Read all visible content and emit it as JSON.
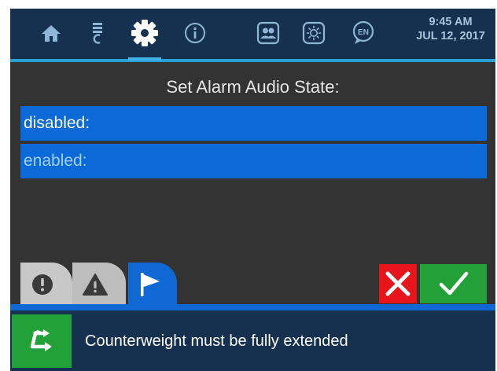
{
  "nav": {
    "icons": [
      "home-icon",
      "lamp-icon",
      "gear-icon",
      "info-icon",
      "users-icon",
      "brightness-icon",
      "language-icon"
    ],
    "language_badge": "EN",
    "active": "gear-icon"
  },
  "clock": {
    "time": "9:45 AM",
    "date": "JUL 12, 2017"
  },
  "page": {
    "title": "Set Alarm Audio State:",
    "options": [
      {
        "label": "disabled:",
        "state": "selected"
      },
      {
        "label": "enabled:",
        "state": "unselected"
      }
    ]
  },
  "tabs": [
    {
      "icon": "error-circle-icon",
      "active": false
    },
    {
      "icon": "warning-triangle-icon",
      "active": false
    },
    {
      "icon": "flag-icon",
      "active": true
    }
  ],
  "actions": {
    "cancel_icon": "close-icon",
    "confirm_icon": "checkmark-icon"
  },
  "status": {
    "icon": "redirect-arrow-icon",
    "message": "Counterweight must be fully extended"
  },
  "colors": {
    "topbar": "#15314f",
    "accent": "#2a9fd6",
    "option_bg": "#0b6ad8",
    "cancel": "#e8141b",
    "confirm": "#23a138",
    "status_icon_bg": "#21a137"
  }
}
